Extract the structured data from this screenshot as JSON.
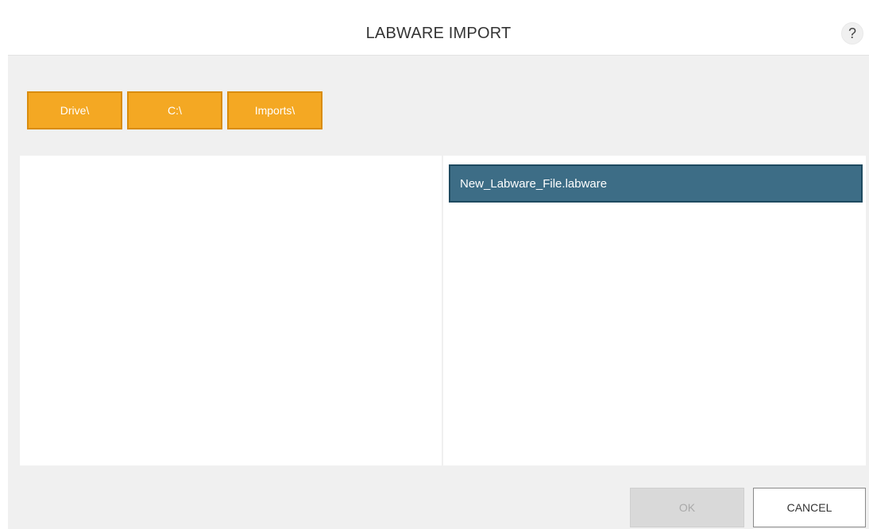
{
  "dialog": {
    "title": "LABWARE IMPORT",
    "help_label": "?"
  },
  "breadcrumbs": [
    {
      "label": "Drive\\"
    },
    {
      "label": "C:\\"
    },
    {
      "label": "Imports\\"
    }
  ],
  "folder_panel": {
    "items": []
  },
  "file_panel": {
    "items": [
      {
        "label": "New_Labware_File.labware",
        "selected": true
      }
    ]
  },
  "footer": {
    "ok_label": "OK",
    "ok_enabled": false,
    "cancel_label": "CANCEL"
  },
  "colors": {
    "breadcrumb_bg": "#f4a823",
    "breadcrumb_border": "#d98c0c",
    "selected_item_bg": "#3d6d86",
    "dialog_bg": "#f0f0f0"
  }
}
